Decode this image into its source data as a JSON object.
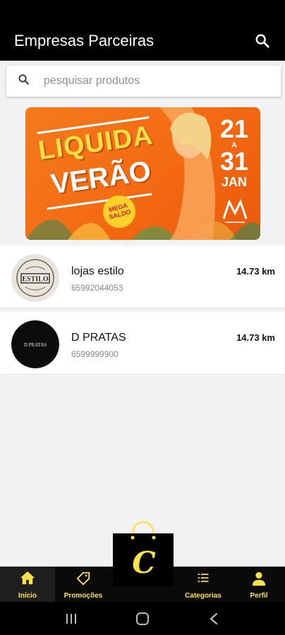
{
  "app": {
    "title": "Empresas Parceiras"
  },
  "search": {
    "placeholder": "pesquisar produtos",
    "value": ""
  },
  "banner": {
    "line1": "LIQUIDA",
    "line2": "VERÃO",
    "date_start": "21",
    "date_sep": "A",
    "date_end": "31",
    "month": "JAN",
    "badge_text": "MEGA SALDO"
  },
  "stores": [
    {
      "name": "lojas estilo",
      "phone": "65992044053",
      "distance": "14.73 km",
      "logo_text": "ESTILO"
    },
    {
      "name": "D PRATAS",
      "phone": "6599999900",
      "distance": "14.73 km",
      "logo_text": "D PRATAS"
    }
  ],
  "nav": {
    "items": [
      {
        "label": "Início",
        "icon": "home-icon"
      },
      {
        "label": "Promoções",
        "icon": "tag-icon"
      },
      {
        "label": "Categorias",
        "icon": "list-icon"
      },
      {
        "label": "Perfil",
        "icon": "person-icon"
      }
    ],
    "center_letter": "C",
    "accent": "#ffe24a"
  },
  "colors": {
    "topbar": "#000000",
    "accent": "#ffe24a",
    "banner": "#f47a1c"
  }
}
